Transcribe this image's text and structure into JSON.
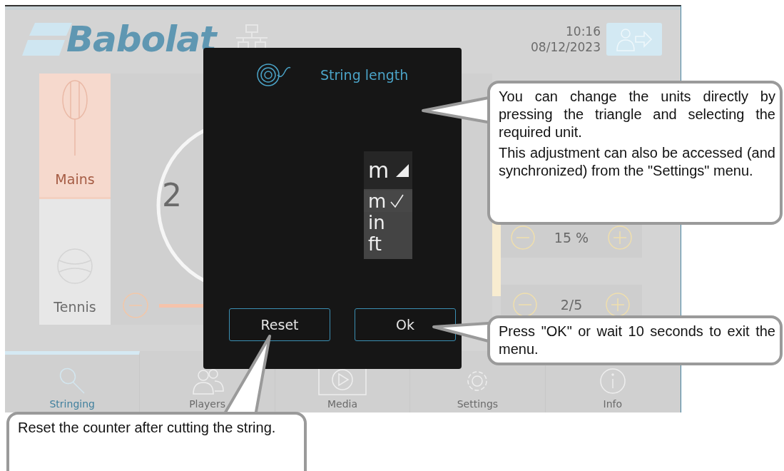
{
  "screen": {
    "logo": "Babolat",
    "time": "10:16",
    "date": "08/12/2023",
    "string_types": [
      {
        "label": "Mains",
        "selected": true
      },
      {
        "label": "Tennis",
        "selected": false
      }
    ],
    "counter": "2",
    "adjusters": [
      {
        "value": "15 %"
      },
      {
        "value": "2/5"
      }
    ],
    "tabs": [
      {
        "label": "Stringing",
        "selected": true
      },
      {
        "label": "Players",
        "selected": false
      },
      {
        "label": "Media",
        "selected": false
      },
      {
        "label": "Settings",
        "selected": false
      },
      {
        "label": "Info",
        "selected": false
      }
    ]
  },
  "dialog": {
    "title": "String length",
    "unit": "m",
    "units": [
      {
        "label": "m",
        "selected": true
      },
      {
        "label": "in",
        "selected": false
      },
      {
        "label": "ft",
        "selected": false
      }
    ],
    "buttons": [
      "Reset",
      "Ok"
    ]
  },
  "callouts": [
    {
      "paragraphs": [
        "You can change the units directly by pressing the triangle and selecting the required unit.",
        "This adjustment can also be accessed (and synchronized) from the \"Settings\" menu."
      ]
    },
    {
      "paragraphs": [
        "Press \"OK\" or wait 10 seconds to exit the menu."
      ]
    },
    {
      "paragraphs": [
        "Reset the counter after cutting the string."
      ]
    }
  ]
}
